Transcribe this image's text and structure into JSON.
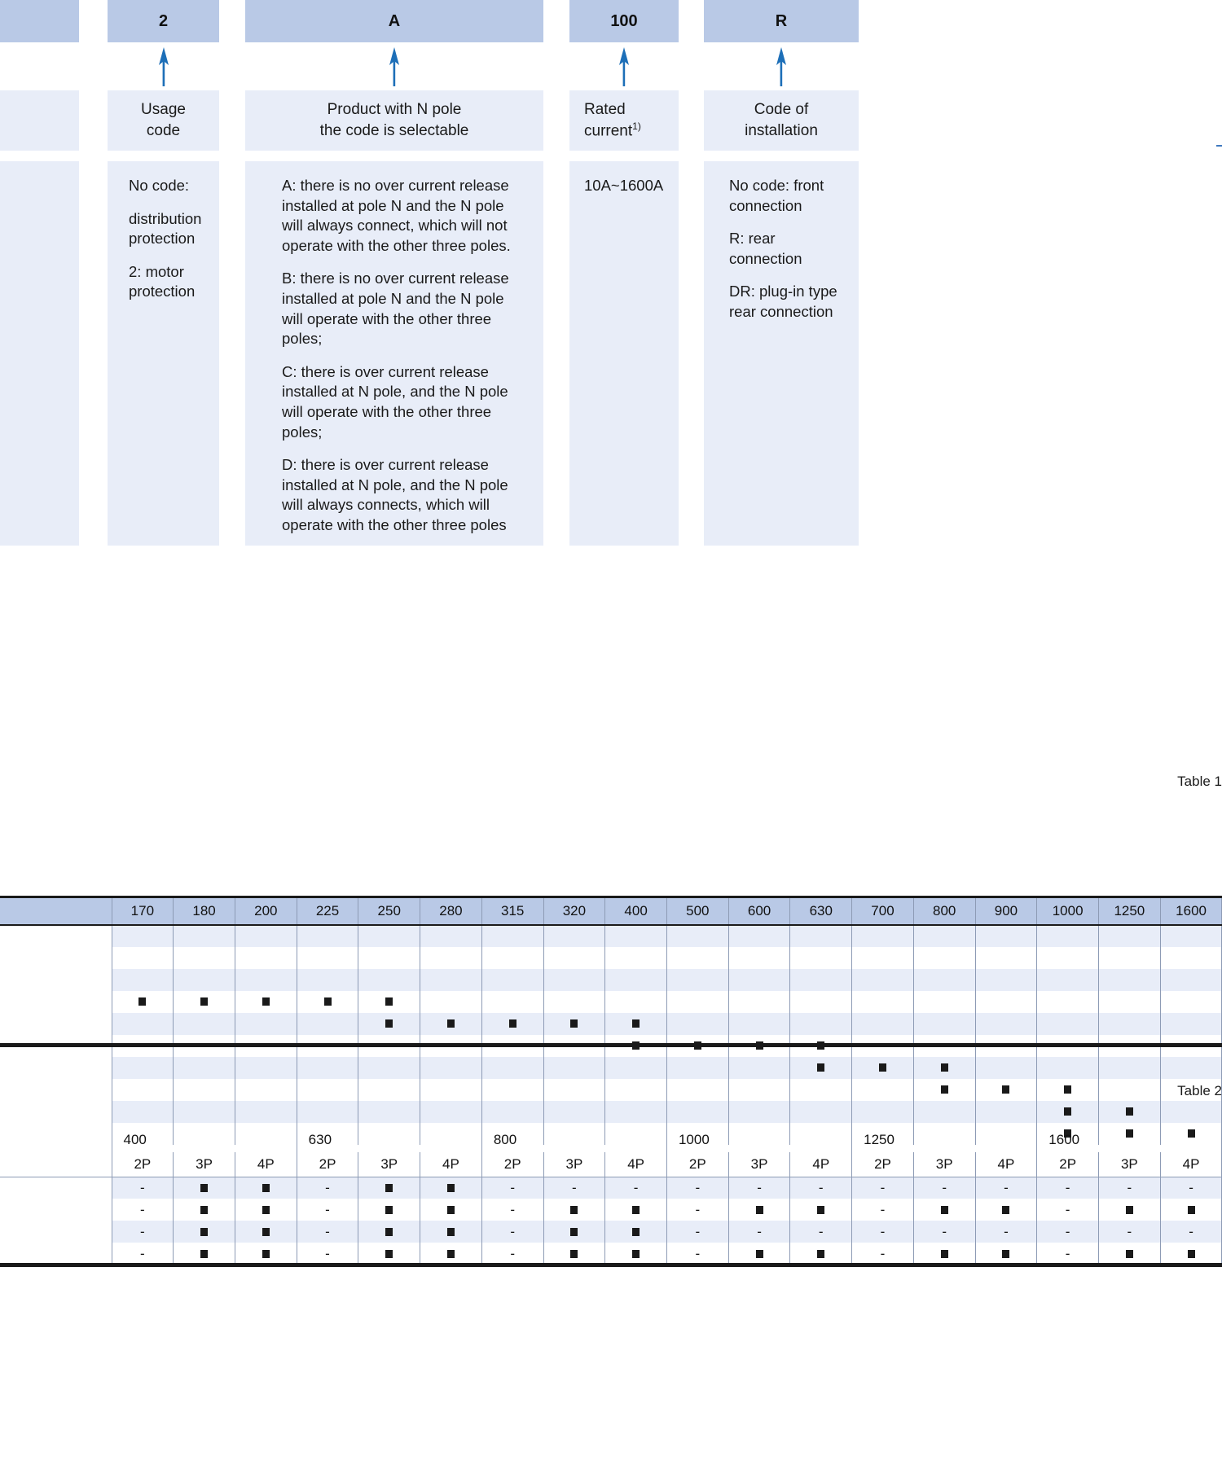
{
  "designation": {
    "columns": [
      {
        "code": "",
        "title": "",
        "details": []
      },
      {
        "code": "2",
        "title": "Usage\ncode",
        "title_lines": [
          "Usage",
          "code"
        ],
        "details": [
          "No code:",
          "distribution protection",
          "2: motor protection"
        ]
      },
      {
        "code": "A",
        "title_lines": [
          "Product with N pole",
          "the code is selectable"
        ],
        "details": [
          "A: there is no over current release installed at pole N and the N pole will always connect, which will not operate with the other three poles.",
          "B: there is no over current release installed at pole N and the N pole will operate with the other three poles;",
          "C: there is over current release installed at N pole, and the N pole will operate with the other three poles;",
          "D: there is over current release installed at N pole, and the N pole will always connects, which will operate with the other three poles"
        ]
      },
      {
        "code": "100",
        "title_lines": [
          "Rated",
          "current"
        ],
        "title_superscript": "1)",
        "details": [
          "10A~1600A"
        ]
      },
      {
        "code": "R",
        "title_lines": [
          "Code of",
          "installation"
        ],
        "details": [
          "No code: front connection",
          "R: rear connection",
          "DR: plug-in type rear connection"
        ]
      }
    ],
    "accent_color": "#1d6fb8",
    "code_box_color": "#b9c9e6",
    "detail_box_color": "#e8edf8"
  },
  "table1": {
    "caption": "Table 1",
    "columns": [
      "170",
      "180",
      "200",
      "225",
      "250",
      "280",
      "315",
      "320",
      "400",
      "500",
      "600",
      "630",
      "700",
      "800",
      "900",
      "1000",
      "1250",
      "1600"
    ],
    "rows": [
      {
        "marks": []
      },
      {
        "marks": []
      },
      {
        "marks": []
      },
      {
        "marks": [
          "170",
          "180",
          "200",
          "225",
          "250"
        ]
      },
      {
        "marks": [
          "250",
          "280",
          "315",
          "320",
          "400"
        ]
      },
      {
        "marks": [
          "400",
          "500",
          "600",
          "630"
        ]
      },
      {
        "marks": [
          "630",
          "700",
          "800"
        ]
      },
      {
        "marks": [
          "800",
          "900",
          "1000"
        ]
      },
      {
        "marks": [
          "1000",
          "1250"
        ]
      },
      {
        "marks": [
          "1000",
          "1250",
          "1600"
        ]
      }
    ]
  },
  "table2": {
    "caption": "Table 2",
    "groups": [
      "400",
      "630",
      "800",
      "1000",
      "1250",
      "1600"
    ],
    "poles": [
      "2P",
      "3P",
      "4P"
    ],
    "rows": [
      {
        "cells": [
          "-",
          "sq",
          "sq",
          "-",
          "sq",
          "sq",
          "-",
          "-",
          "-",
          "-",
          "-",
          "-",
          "-",
          "-",
          "-",
          "-",
          "-",
          "-"
        ]
      },
      {
        "cells": [
          "-",
          "sq",
          "sq",
          "-",
          "sq",
          "sq",
          "-",
          "sq",
          "sq",
          "-",
          "sq",
          "sq",
          "-",
          "sq",
          "sq",
          "-",
          "sq",
          "sq"
        ]
      },
      {
        "cells": [
          "-",
          "sq",
          "sq",
          "-",
          "sq",
          "sq",
          "-",
          "sq",
          "sq",
          "-",
          "-",
          "-",
          "-",
          "-",
          "-",
          "-",
          "-",
          "-"
        ]
      },
      {
        "cells": [
          "-",
          "sq",
          "sq",
          "-",
          "sq",
          "sq",
          "-",
          "sq",
          "sq",
          "-",
          "sq",
          "sq",
          "-",
          "sq",
          "sq",
          "-",
          "sq",
          "sq"
        ]
      }
    ]
  }
}
